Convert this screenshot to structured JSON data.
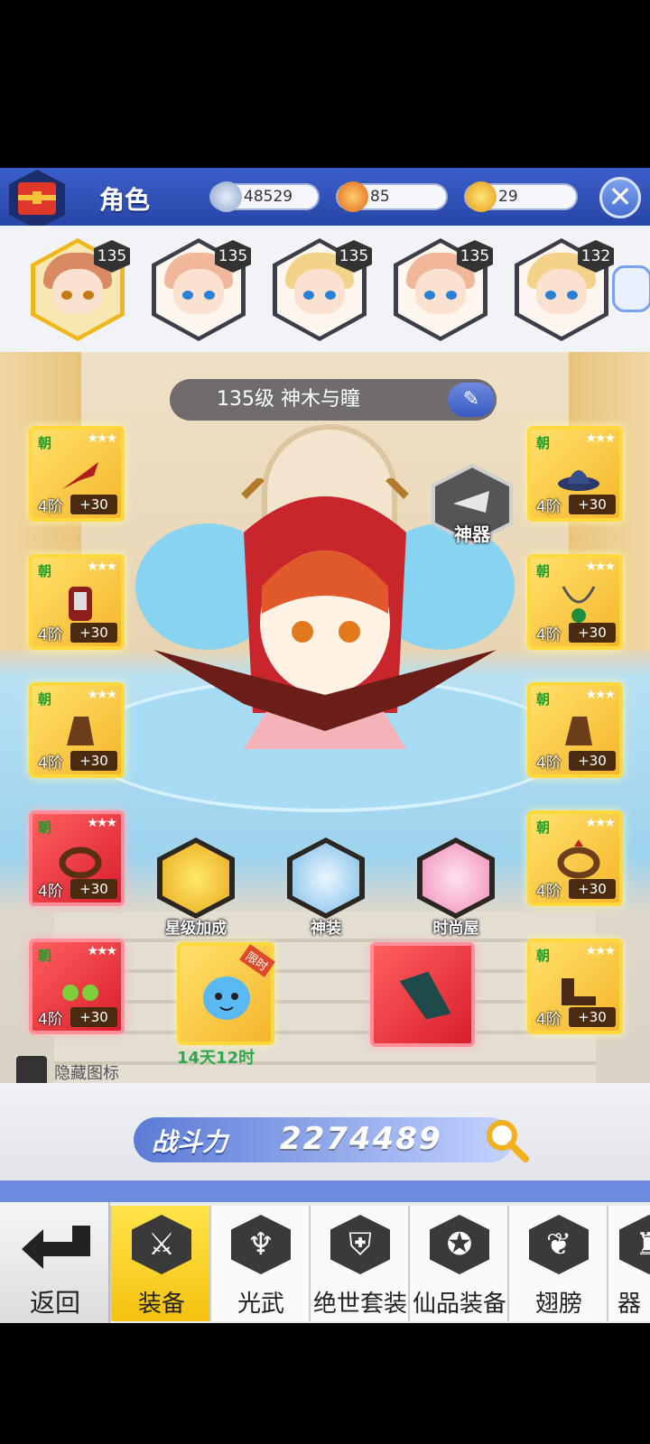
{
  "header": {
    "title": "角色",
    "currencies": [
      {
        "name": "diamond-icon",
        "value": "48529",
        "color": "#9fb4d6"
      },
      {
        "name": "orange-gem-icon",
        "value": "85",
        "color": "#e8771c"
      },
      {
        "name": "gold-coin-icon",
        "value": "29",
        "color": "#f2b01e"
      }
    ],
    "close_label": "✕"
  },
  "heroes": [
    {
      "level": "135",
      "selected": true,
      "hair": "#d98a62"
    },
    {
      "level": "135",
      "selected": false,
      "hair": "#f0b79a"
    },
    {
      "level": "135",
      "selected": false,
      "hair": "#f3d38a"
    },
    {
      "level": "135",
      "selected": false,
      "hair": "#f0b79a"
    },
    {
      "level": "132",
      "selected": false,
      "hair": "#f3d38a"
    }
  ],
  "character": {
    "name": "135级 神木与瞳",
    "artifact_label": "神器"
  },
  "slots": {
    "tag": "朝",
    "stars": "★★★",
    "grade": "4阶",
    "plus": "+30"
  },
  "center_buttons": [
    {
      "label": "星级加成",
      "icon": "star-bonus-icon"
    },
    {
      "label": "神装",
      "icon": "divine-gear-icon"
    },
    {
      "label": "时尚屋",
      "icon": "fashion-house-icon"
    }
  ],
  "special": {
    "pet_tag": "限时",
    "timer": "14天12时"
  },
  "hide_icons_label": "隐藏图标",
  "power": {
    "label": "战斗力",
    "value": "2274489"
  },
  "tabs": {
    "back_label": "返回",
    "items": [
      {
        "label": "装备",
        "icon": "crossed-swords-icon",
        "active": true
      },
      {
        "label": "光武",
        "icon": "trident-icon",
        "active": false
      },
      {
        "label": "绝世套装",
        "icon": "armor-icon",
        "active": false
      },
      {
        "label": "仙品装备",
        "icon": "emblem-icon",
        "active": false
      },
      {
        "label": "翅膀",
        "icon": "wing-icon",
        "active": false
      },
      {
        "label": "器",
        "icon": "partial-tab-icon",
        "active": false
      }
    ]
  }
}
